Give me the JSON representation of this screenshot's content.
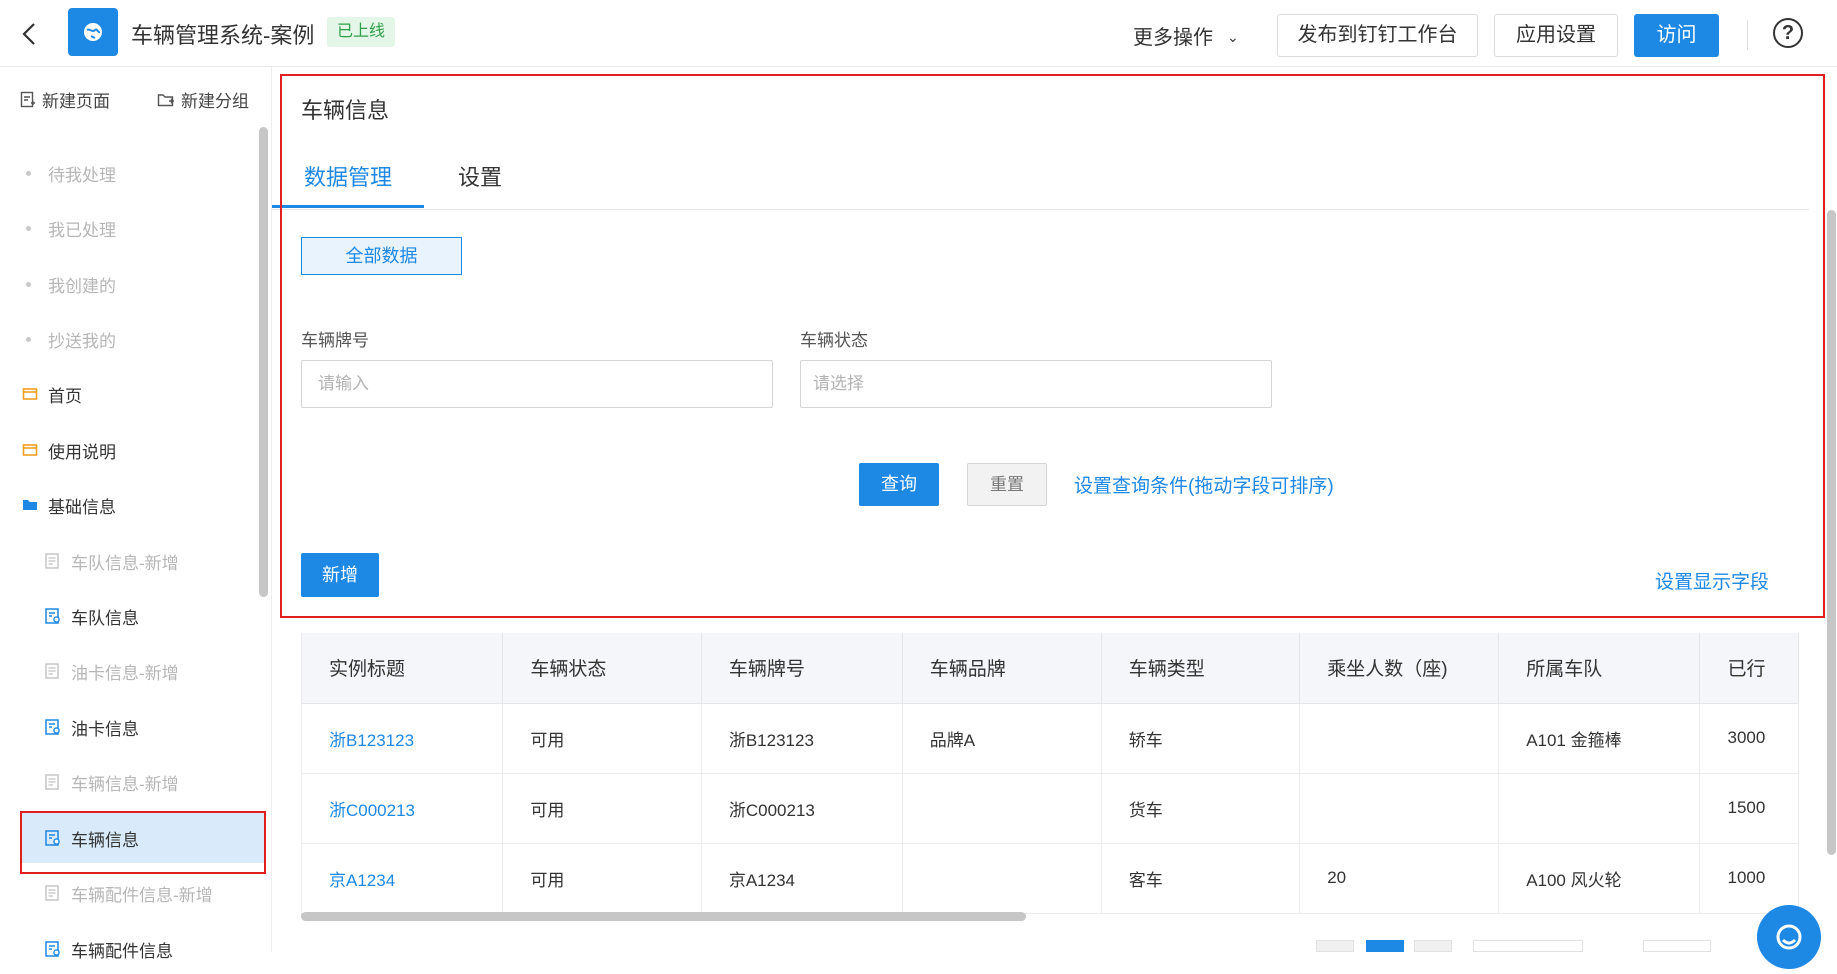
{
  "topbar": {
    "app_title": "车辆管理系统-案例",
    "status_badge": "已上线",
    "more_ops": "更多操作",
    "publish": "发布到钉钉工作台",
    "app_settings": "应用设置",
    "visit": "访问",
    "help": "?"
  },
  "sidebar": {
    "new_page": "新建页面",
    "new_group": "新建分组",
    "items": [
      {
        "label": "待我处理",
        "style": "dim",
        "icon": "bullet"
      },
      {
        "label": "我已处理",
        "style": "dim",
        "icon": "bullet"
      },
      {
        "label": "我创建的",
        "style": "dim",
        "icon": "bullet"
      },
      {
        "label": "抄送我的",
        "style": "dim",
        "icon": "bullet"
      },
      {
        "label": "首页",
        "style": "normal",
        "icon": "folder-icon"
      },
      {
        "label": "使用说明",
        "style": "normal",
        "icon": "folder-icon"
      },
      {
        "label": "基础信息",
        "style": "normal",
        "icon": "folder-open-icon"
      },
      {
        "label": "车队信息-新增",
        "style": "dim",
        "icon": "form-icon"
      },
      {
        "label": "车队信息",
        "style": "normal",
        "icon": "report-icon"
      },
      {
        "label": "油卡信息-新增",
        "style": "dim",
        "icon": "form-icon"
      },
      {
        "label": "油卡信息",
        "style": "normal",
        "icon": "report-icon"
      },
      {
        "label": "车辆信息-新增",
        "style": "dim",
        "icon": "form-icon"
      },
      {
        "label": "车辆信息",
        "style": "active",
        "icon": "report-icon"
      },
      {
        "label": "车辆配件信息-新增",
        "style": "dim",
        "icon": "form-icon"
      },
      {
        "label": "车辆配件信息",
        "style": "normal",
        "icon": "report-icon"
      }
    ]
  },
  "main": {
    "page_title": "车辆信息",
    "tabs": [
      "数据管理",
      "设置"
    ],
    "filter_all": "全部数据",
    "fields": {
      "plate_label": "车辆牌号",
      "plate_placeholder": "请输入",
      "status_label": "车辆状态",
      "status_placeholder": "请选择"
    },
    "query": "查询",
    "reset": "重置",
    "query_settings_link": "设置查询条件(拖动字段可排序)",
    "add": "新增",
    "display_fields_link": "设置显示字段"
  },
  "table": {
    "columns": [
      "实例标题",
      "车辆状态",
      "车辆牌号",
      "车辆品牌",
      "车辆类型",
      "乘坐人数（座)",
      "所属车队",
      "已行"
    ],
    "rows": [
      [
        "浙B123123",
        "可用",
        "浙B123123",
        "品牌A",
        "轿车",
        "",
        "A101 金箍棒",
        "3000"
      ],
      [
        "浙C000213",
        "可用",
        "浙C000213",
        "",
        "货车",
        "",
        "",
        "1500"
      ],
      [
        "京A1234",
        "可用",
        "京A1234",
        "",
        "客车",
        "20",
        "A100 风火轮",
        "1000"
      ]
    ]
  },
  "colors": {
    "primary": "#1e88e5",
    "highlight_border": "#e02020",
    "badge_green": "#2e9e4a"
  }
}
